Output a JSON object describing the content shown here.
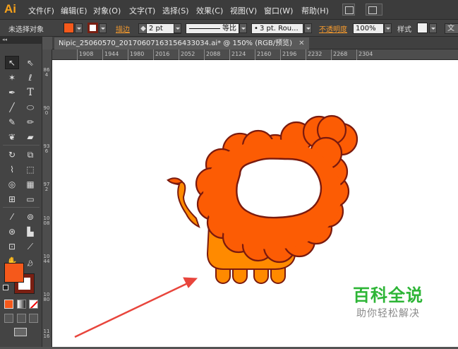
{
  "app": {
    "logo": "Ai"
  },
  "menubar": {
    "items": [
      "文件(F)",
      "编辑(E)",
      "对象(O)",
      "文字(T)",
      "选择(S)",
      "效果(C)",
      "视图(V)",
      "窗口(W)",
      "帮助(H)"
    ]
  },
  "controlbar": {
    "selection_label": "未选择对象",
    "fill_color": "#f5591b",
    "stroke_color": "#7a1f12",
    "stroke_label": "描边",
    "stroke_weight": "2 pt",
    "stroke_profile": "等比",
    "brush": "3 pt. Rou...",
    "opacity_label": "不透明度",
    "opacity_value": "100%",
    "style_label": "样式",
    "doc_setup_label": "文"
  },
  "document": {
    "tab_title": "Nipic_25060570_20170607163156433034.ai* @ 150% (RGB/预览)"
  },
  "ruler": {
    "horizontal": [
      "1908",
      "1944",
      "1980",
      "2016",
      "2052",
      "2088",
      "2124",
      "2160",
      "2196",
      "2232",
      "2268",
      "2304"
    ],
    "vertical": [
      "864",
      "900",
      "936",
      "972",
      "1008",
      "1044",
      "1080",
      "1116"
    ]
  },
  "tools": {
    "fill_color": "#f5591b",
    "stroke_color": "#7a1f12"
  },
  "artwork": {
    "mane_color": "#fc5c04",
    "body_color": "#ff8a00",
    "outline_color": "#7a1a0e",
    "arrow_color": "#e8453c"
  },
  "watermark": {
    "title": "百科全说",
    "subtitle": "助你轻松解决",
    "color": "#2db536"
  }
}
